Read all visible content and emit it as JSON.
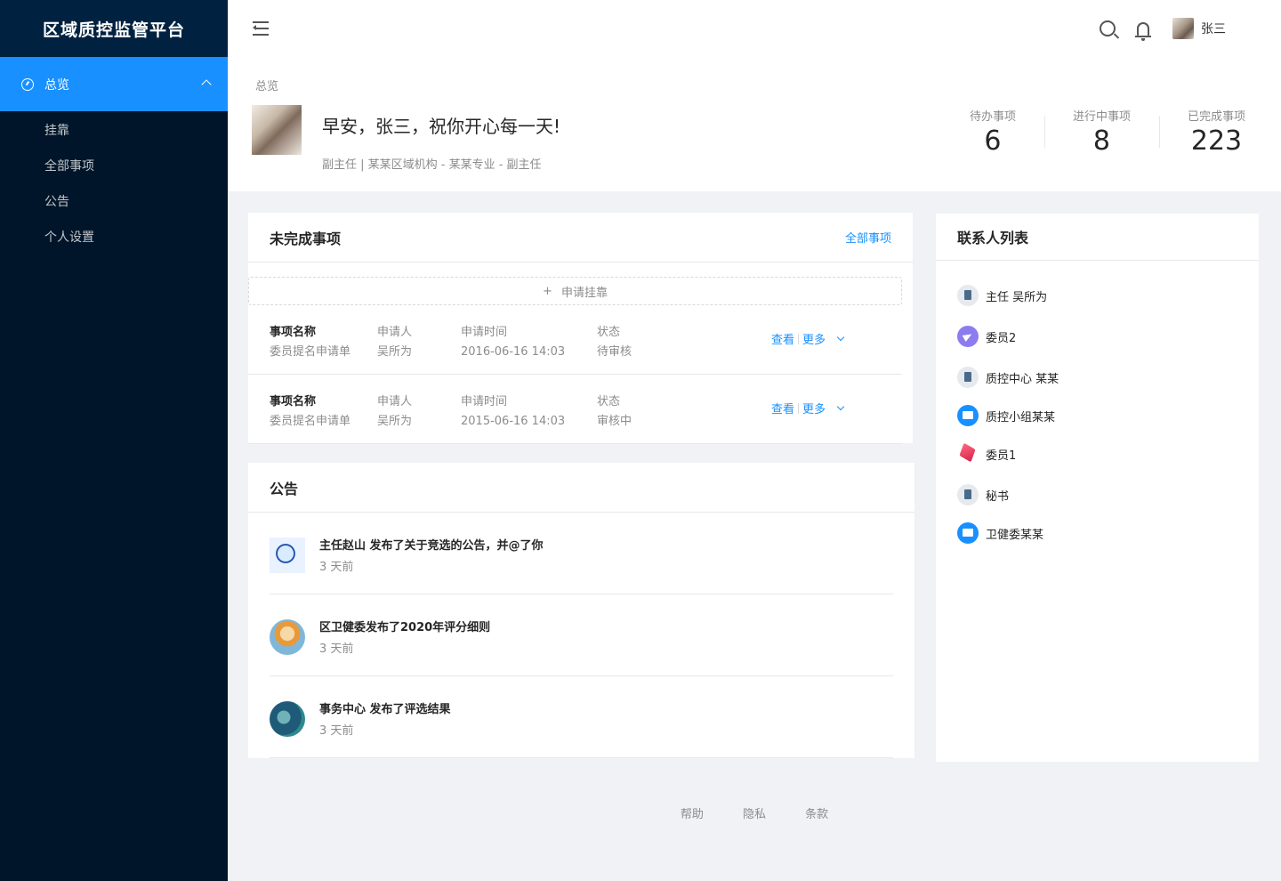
{
  "app": {
    "title": "区域质控监管平台"
  },
  "sidebar": {
    "active": {
      "label": "总览",
      "icon": "dashboard-icon"
    },
    "items": [
      {
        "label": "挂靠"
      },
      {
        "label": "全部事项"
      },
      {
        "label": "公告"
      },
      {
        "label": "个人设置"
      }
    ]
  },
  "header": {
    "user_name": "张三"
  },
  "page": {
    "breadcrumb": "总览",
    "greeting": "早安，张三，祝你开心每一天!",
    "subline": "副主任 |  某某区域机构 - 某某专业 - 副主任",
    "stats": [
      {
        "label": "待办事项",
        "value": "6"
      },
      {
        "label": "进行中事项",
        "value": "8"
      },
      {
        "label": "已完成事项",
        "value": "223"
      }
    ]
  },
  "tasks": {
    "title": "未完成事项",
    "all_link": "全部事项",
    "apply_label": "申请挂靠",
    "plus": "+",
    "rows": [
      {
        "name_label": "事项名称",
        "name": "委员提名申请单",
        "applicant_label": "申请人",
        "applicant": "吴所为",
        "time_label": "申请时间",
        "time": "2016-06-16  14:03",
        "status_label": "状态",
        "status": "待审核",
        "view": "查看",
        "more": "更多"
      },
      {
        "name_label": "事项名称",
        "name": "委员提名申请单",
        "applicant_label": "申请人",
        "applicant": "吴所为",
        "time_label": "申请时间",
        "time": "2015-06-16  14:03",
        "status_label": "状态",
        "status": "审核中",
        "view": "查看",
        "more": "更多"
      }
    ]
  },
  "notices": {
    "title": "公告",
    "items": [
      {
        "title": "主任赵山 发布了关于竞选的公告，并@了你",
        "time": "3 天前"
      },
      {
        "title": "区卫健委发布了2020年评分细则",
        "time": "3 天前"
      },
      {
        "title": "事务中心 发布了评选结果",
        "time": "3 天前"
      }
    ]
  },
  "contacts": {
    "title": "联系人列表",
    "items": [
      {
        "name": "主任 吴所为",
        "icon": "book-icon"
      },
      {
        "name": "委员2",
        "icon": "plane-icon"
      },
      {
        "name": "质控中心 某某",
        "icon": "book-icon"
      },
      {
        "name": "质控小组某某",
        "icon": "mail-icon"
      },
      {
        "name": "委员1",
        "icon": "cube-icon"
      },
      {
        "name": "秘书",
        "icon": "book-icon"
      },
      {
        "name": "卫健委某某",
        "icon": "mail-icon"
      }
    ]
  },
  "footer": {
    "links": [
      "帮助",
      "隐私",
      "条款"
    ]
  },
  "colors": {
    "primary": "#1890ff",
    "sidebar": "#001529",
    "pending": "#52c41a",
    "review": "#faad14"
  }
}
